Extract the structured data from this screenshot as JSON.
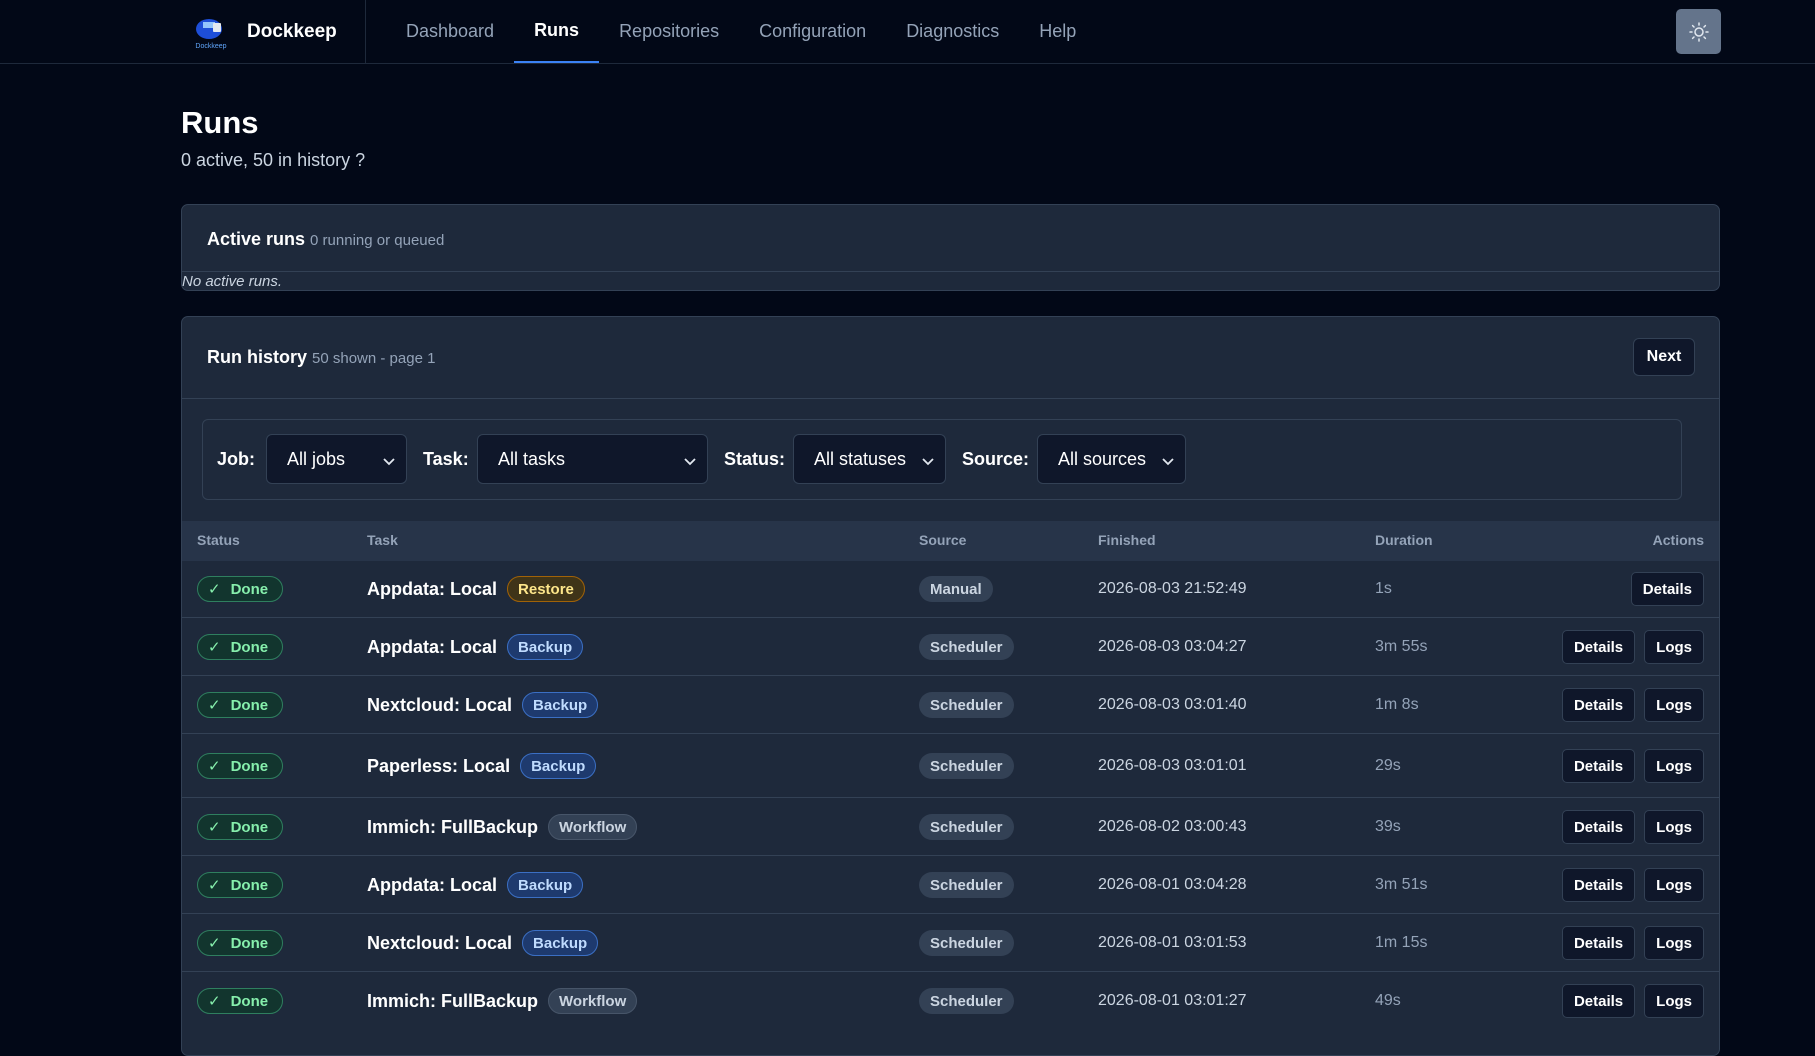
{
  "app": {
    "brand": "Dockkeep",
    "logo_text": "Dockkeep",
    "nav": [
      {
        "label": "Dashboard",
        "active": false
      },
      {
        "label": "Runs",
        "active": true
      },
      {
        "label": "Repositories",
        "active": false
      },
      {
        "label": "Configuration",
        "active": false
      },
      {
        "label": "Diagnostics",
        "active": false
      },
      {
        "label": "Help",
        "active": false
      }
    ],
    "theme_icon": "sun-icon"
  },
  "page": {
    "title": "Runs",
    "subtitle": "0 active, 50 in history ?"
  },
  "active_runs": {
    "title": "Active runs",
    "subtitle": "0 running or queued",
    "empty": "No active runs."
  },
  "history": {
    "title": "Run history",
    "subtitle": "50 shown - page 1",
    "next_label": "Next",
    "filters": [
      {
        "label": "Job:",
        "value": "All jobs"
      },
      {
        "label": "Task:",
        "value": "All tasks"
      },
      {
        "label": "Status:",
        "value": "All statuses"
      },
      {
        "label": "Source:",
        "value": "All sources"
      }
    ],
    "columns": {
      "status": "Status",
      "task": "Task",
      "source": "Source",
      "finished": "Finished",
      "duration": "Duration",
      "actions": "Actions"
    },
    "rows": [
      {
        "status": "Done",
        "task": "Appdata: Local",
        "type": "Restore",
        "source": "Manual",
        "finished": "2026-08-03 21:52:49",
        "duration": "1s",
        "actions": [
          "Details"
        ]
      },
      {
        "status": "Done",
        "task": "Appdata: Local",
        "type": "Backup",
        "source": "Scheduler",
        "finished": "2026-08-03 03:04:27",
        "duration": "3m 55s",
        "actions": [
          "Details",
          "Logs"
        ]
      },
      {
        "status": "Done",
        "task": "Nextcloud: Local",
        "type": "Backup",
        "source": "Scheduler",
        "finished": "2026-08-03 03:01:40",
        "duration": "1m 8s",
        "actions": [
          "Details",
          "Logs"
        ]
      },
      {
        "status": "Done",
        "task": "Paperless: Local",
        "type": "Backup",
        "source": "Scheduler",
        "finished": "2026-08-03 03:01:01",
        "duration": "29s",
        "actions": [
          "Details",
          "Logs"
        ]
      },
      {
        "status": "Done",
        "task": "Immich: FullBackup",
        "type": "Workflow",
        "source": "Scheduler",
        "finished": "2026-08-02 03:00:43",
        "duration": "39s",
        "actions": [
          "Details",
          "Logs"
        ]
      },
      {
        "status": "Done",
        "task": "Appdata: Local",
        "type": "Backup",
        "source": "Scheduler",
        "finished": "2026-08-01 03:04:28",
        "duration": "3m 51s",
        "actions": [
          "Details",
          "Logs"
        ]
      },
      {
        "status": "Done",
        "task": "Nextcloud: Local",
        "type": "Backup",
        "source": "Scheduler",
        "finished": "2026-08-01 03:01:53",
        "duration": "1m 15s",
        "actions": [
          "Details",
          "Logs"
        ]
      },
      {
        "status": "Done",
        "task": "Immich: FullBackup",
        "type": "Workflow",
        "source": "Scheduler",
        "finished": "2026-08-01 03:01:27",
        "duration": "49s",
        "actions": [
          "Details",
          "Logs"
        ]
      }
    ]
  },
  "colors": {
    "background": "#020817",
    "card": "#1e293b",
    "accent": "#3b82f6",
    "success": "#86efac"
  }
}
